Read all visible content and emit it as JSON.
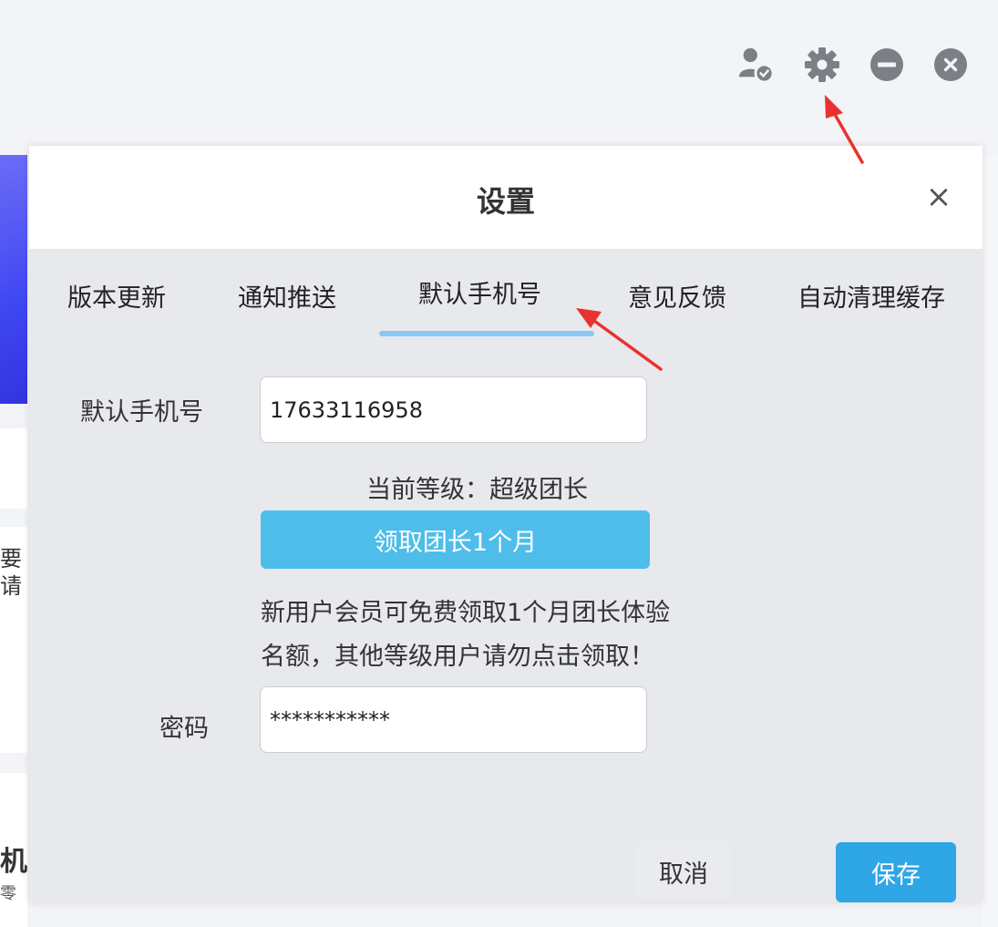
{
  "titlebar": {
    "icons": [
      "user-check-icon",
      "gear-icon",
      "minimize-icon",
      "close-icon"
    ]
  },
  "background": {
    "fragment_1": "要",
    "fragment_2": "请",
    "fragment_3": "机",
    "fragment_4": "零"
  },
  "dialog": {
    "title": "设置",
    "close_label": "×",
    "tabs": [
      {
        "label": "版本更新"
      },
      {
        "label": "通知推送"
      },
      {
        "label": "默认手机号",
        "active": true
      },
      {
        "label": "意见反馈"
      },
      {
        "label": "自动清理缓存"
      }
    ],
    "phone": {
      "label": "默认手机号",
      "value": "17633116958"
    },
    "level_text": "当前等级：超级团长",
    "claim_button": "领取团长1个月",
    "notice_lines": [
      "新用户会员可免费领取1个月团长体验",
      "名额，其他等级用户请勿点击领取！"
    ],
    "password": {
      "label": "密码",
      "value": "***********"
    },
    "cancel_label": "取消",
    "save_label": "保存"
  },
  "colors": {
    "accent": "#4fbde9",
    "save": "#2fa6e6",
    "tab_underline": "#88c8f2",
    "arrow": "#e8322f",
    "banner": "#3f47f2"
  }
}
